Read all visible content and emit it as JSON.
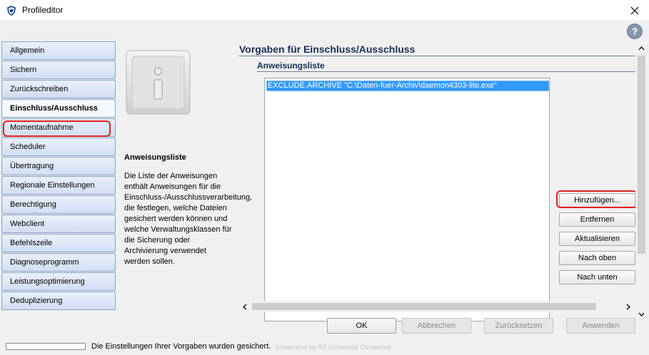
{
  "window": {
    "title": "Profileditor"
  },
  "sidebar": {
    "items": [
      {
        "label": "Allgemein",
        "active": false
      },
      {
        "label": "Sichern",
        "active": false
      },
      {
        "label": "Zurückschreiben",
        "active": false
      },
      {
        "label": "Einschluss/Ausschluss",
        "active": true
      },
      {
        "label": "Momentaufnahme",
        "active": false
      },
      {
        "label": "Scheduler",
        "active": false
      },
      {
        "label": "Übertragung",
        "active": false
      },
      {
        "label": "Regionale Einstellungen",
        "active": false
      },
      {
        "label": "Berechtigung",
        "active": false
      },
      {
        "label": "Webclient",
        "active": false
      },
      {
        "label": "Befehlszeile",
        "active": false
      },
      {
        "label": "Diagnoseprogramm",
        "active": false
      },
      {
        "label": "Leistungsoptimierung",
        "active": false
      },
      {
        "label": "Deduplizierung",
        "active": false
      }
    ]
  },
  "info": {
    "title": "Anweisungsliste",
    "description": "Die Liste der Anweisungen enthält Anweisungen für die Einschluss-/Ausschlussverarbeitung, die festlegen, welche Dateien gesichert werden können und welche Verwaltungsklassen für die Sicherung oder Archivierung verwendet werden sollen."
  },
  "main": {
    "section_title": "Vorgaben für Einschluss/Ausschluss",
    "subsection_title": "Anweisungsliste",
    "list": {
      "items": [
        "EXCLUDE.ARCHIVE \"C:\\Daten-fuer-Archiv\\daemon4303-lite.exe\""
      ]
    },
    "buttons": {
      "add": "Hinzufügen...",
      "remove": "Entfernen",
      "update": "Aktualisieren",
      "up": "Nach oben",
      "down": "Nach unten"
    }
  },
  "footer": {
    "ok": "OK",
    "cancel": "Abbrechen",
    "reset": "Zurücksetzen",
    "apply": "Anwenden"
  },
  "status": {
    "message": "Die Einstellungen Ihrer Vorgaben wurden gesichert.",
    "watermark": "Screenshot by RZ Universität Osnabrück",
    "progress_percent": 0
  },
  "colors": {
    "accent_highlight": "#e02020",
    "selection": "#3399ff",
    "heading": "#1a2d52"
  },
  "icons": {
    "app": "shield-icon",
    "close": "close-icon",
    "help": "help-icon",
    "info": "info-icon"
  }
}
